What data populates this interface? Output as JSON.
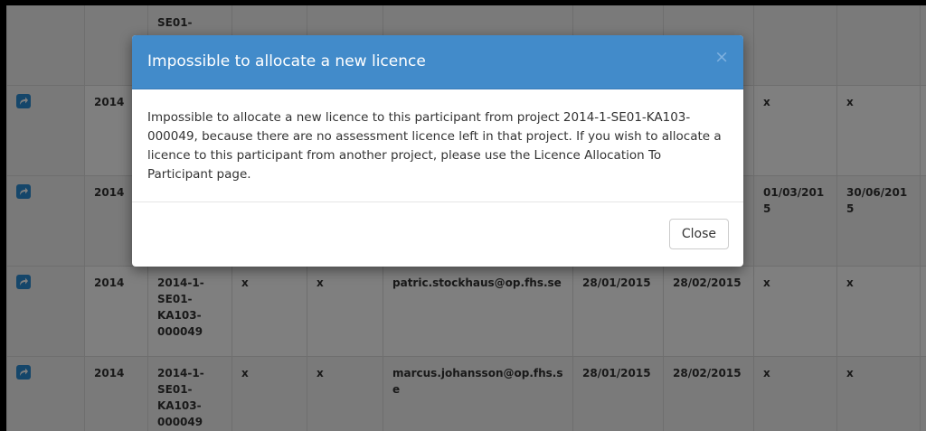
{
  "table": {
    "rows": [
      {
        "year": "",
        "project": [
          "SE01-"
        ],
        "col3": "",
        "col4": "",
        "email": "",
        "start": "",
        "end": "",
        "col8": "",
        "col9": ""
      },
      {
        "year": "2014",
        "project": [],
        "col3": "",
        "col4": "",
        "email": "",
        "start": "",
        "end": "",
        "col8": "x",
        "col9": "x"
      },
      {
        "year": "2014",
        "project": [],
        "col3": "",
        "col4": "",
        "email": "",
        "start": "",
        "end": "",
        "col8": "01/03/2015",
        "col9": "30/06/2015"
      },
      {
        "year": "2014",
        "project": [
          "2014-1-",
          "SE01-",
          "KA103-",
          "000049"
        ],
        "col3": "x",
        "col4": "x",
        "email": "patric.stockhaus@op.fhs.se",
        "start": "28/01/2015",
        "end": "28/02/2015",
        "col8": "x",
        "col9": "x"
      },
      {
        "year": "2014",
        "project": [
          "2014-1-",
          "SE01-",
          "KA103-",
          "000049"
        ],
        "col3": "x",
        "col4": "x",
        "email": "marcus.johansson@op.fhs.se",
        "start": "28/01/2015",
        "end": "28/02/2015",
        "col8": "x",
        "col9": "x"
      }
    ]
  },
  "modal": {
    "title": "Impossible to allocate a new licence",
    "close_x": "×",
    "message": "Impossible to allocate a new licence to this participant from project 2014-1-SE01-KA103-000049, because there are no assessment licence left in that project. If you wish to allocate a licence to this participant from another project, please use the Licence Allocation To Participant page.",
    "close_label": "Close"
  },
  "icons": {
    "row_action": "share-arrow-icon"
  },
  "colors": {
    "header": "#428bca",
    "icon": "#2a8dd4"
  }
}
